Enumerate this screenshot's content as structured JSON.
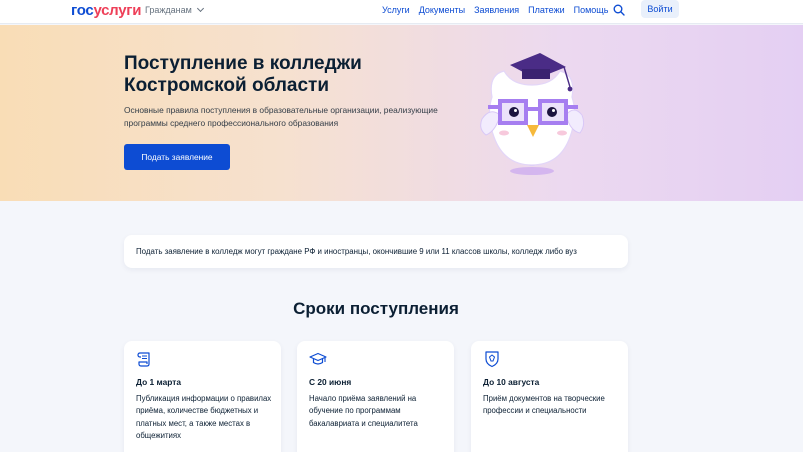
{
  "header": {
    "logo_part1": "гос",
    "logo_part2": "услуги",
    "audience_label": "Гражданам",
    "nav": [
      "Услуги",
      "Документы",
      "Заявления",
      "Платежи",
      "Помощь"
    ],
    "login_label": "Войти"
  },
  "hero": {
    "title": "Поступление в колледжи Костромской области",
    "subtitle": "Основные правила поступления в образовательные организации, реализующие программы среднего профессионального образования",
    "apply_label": "Подать заявление"
  },
  "info_text": "Подать заявление в колледж могут граждане РФ и иностранцы, окончившие 9 или 11 классов школы, колледж либо вуз",
  "section_title": "Сроки поступления",
  "cards": [
    {
      "icon": "scroll-icon",
      "date": "До 1 марта",
      "desc": "Публикация информации о правилах приёма, количестве бюджетных и платных мест, а также местах в общежитиях"
    },
    {
      "icon": "graduation-cap-icon",
      "date": "С 20 июня",
      "desc": "Начало приёма заявлений на обучение по программам бакалавриата и специалитета"
    },
    {
      "icon": "shield-icon",
      "date": "До 10 августа",
      "desc": "Приём документов на творческие профессии и специальности"
    }
  ],
  "colors": {
    "brand_blue": "#0d4cd3",
    "brand_red": "#ee3f58",
    "text": "#0b1f33",
    "owl_purple": "#a67ef0"
  }
}
